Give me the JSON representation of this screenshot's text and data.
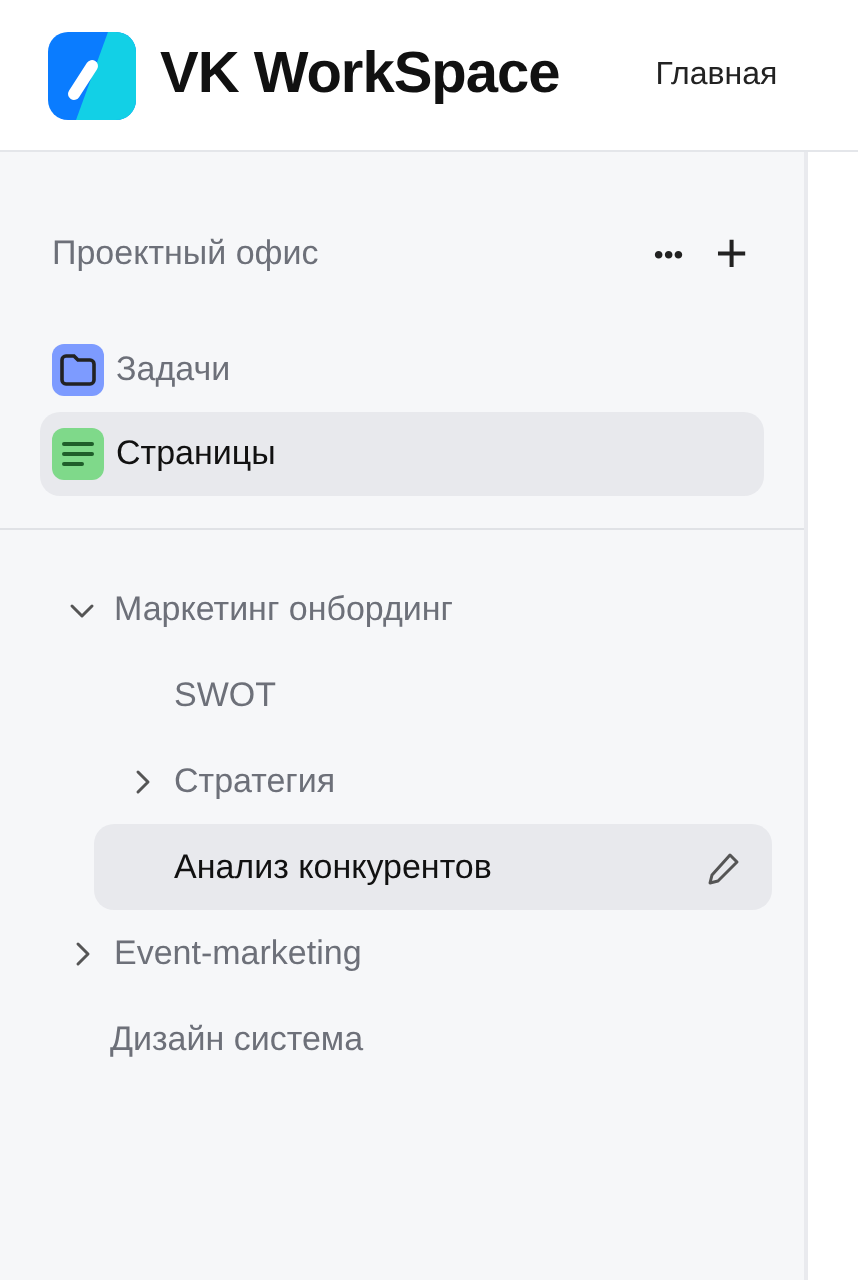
{
  "header": {
    "logo_text": "VK WorkSpace",
    "nav_link": "Главная"
  },
  "sidebar": {
    "title": "Проектный офис",
    "more_button": "•••",
    "add_button": "+",
    "sections": [
      {
        "kind": "folder",
        "label": "Задачи",
        "selected": false
      },
      {
        "kind": "pages",
        "label": "Страницы",
        "selected": true
      }
    ],
    "tree": [
      {
        "label": "Маркетинг онбординг",
        "expanded": true,
        "selected": false,
        "children": [
          {
            "label": "SWOT",
            "selected": false
          },
          {
            "label": "Стратегия",
            "expanded": false,
            "selected": false
          },
          {
            "label": "Анализ конкурентов",
            "selected": true
          }
        ]
      },
      {
        "label": "Event-marketing",
        "expanded": false,
        "selected": false
      },
      {
        "label": "Дизайн система",
        "selected": false
      }
    ]
  }
}
